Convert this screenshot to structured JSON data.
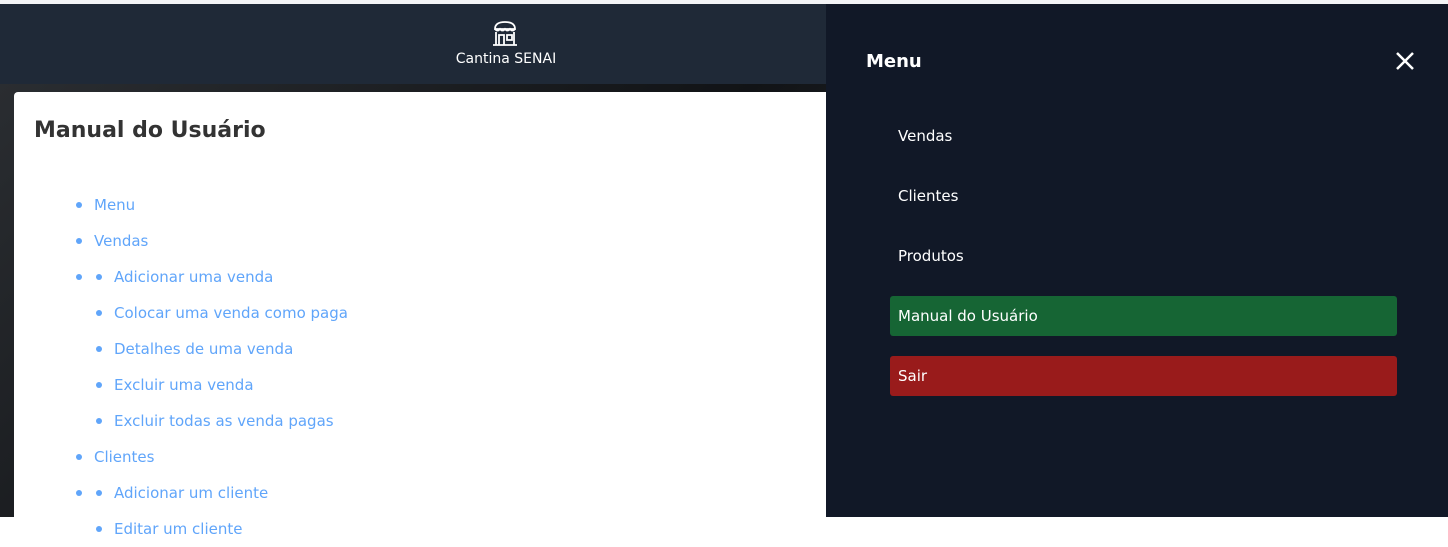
{
  "header": {
    "app_title": "Cantina SENAI",
    "logo_icon": "store-icon"
  },
  "manual": {
    "title": "Manual do Usuário",
    "sections": [
      {
        "label": "Menu",
        "items": []
      },
      {
        "label": "Vendas",
        "items": [
          "Adicionar uma venda",
          "Colocar uma venda como paga",
          "Detalhes de uma venda",
          "Excluir uma venda",
          "Excluir todas as venda pagas"
        ]
      },
      {
        "label": "Clientes",
        "items": [
          "Adicionar um cliente",
          "Editar um cliente"
        ]
      }
    ]
  },
  "menu": {
    "title": "Menu",
    "items": [
      {
        "label": "Vendas"
      },
      {
        "label": "Clientes"
      },
      {
        "label": "Produtos"
      },
      {
        "label": "Manual do Usuário",
        "active": true
      },
      {
        "label": "Sair",
        "danger": true
      }
    ],
    "colors": {
      "active": "#166534",
      "danger": "#991b1b"
    }
  }
}
